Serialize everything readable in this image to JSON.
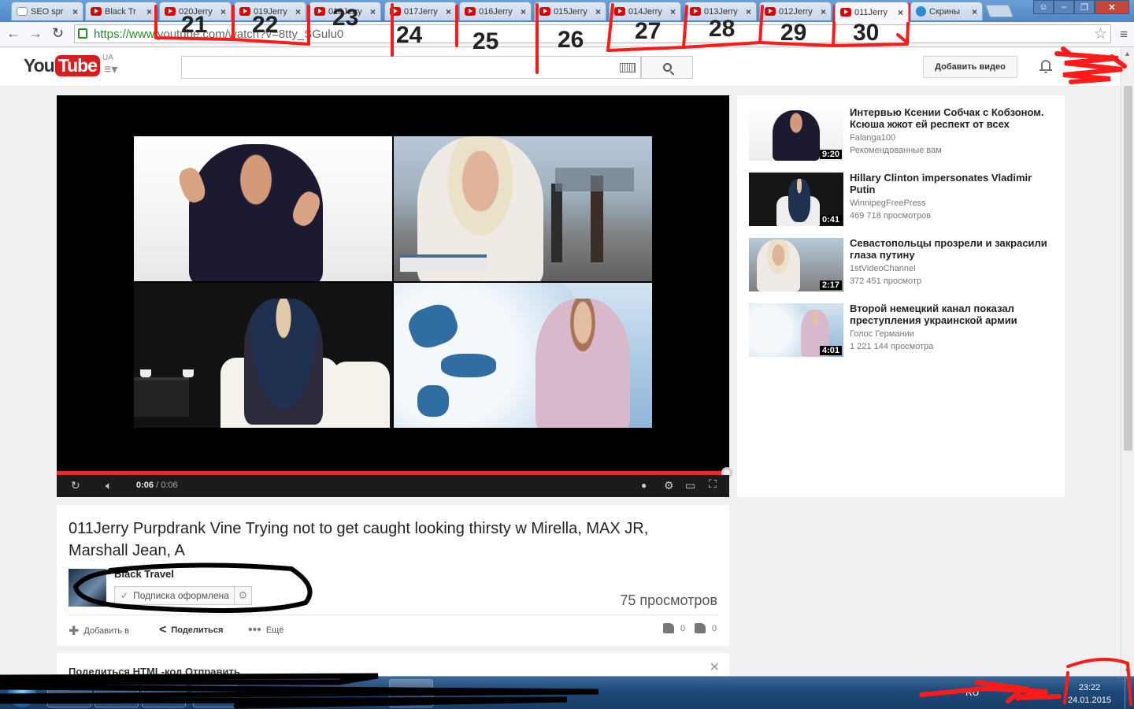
{
  "browser": {
    "tabs": [
      {
        "icon": "seo-favicon-icon",
        "label": "SEO spr",
        "number": ""
      },
      {
        "icon": "youtube-favicon-icon",
        "label": "Black Tr",
        "number": ""
      },
      {
        "icon": "youtube-favicon-icon",
        "label": "020Jerry",
        "number": "21"
      },
      {
        "icon": "youtube-favicon-icon",
        "label": "019Jerry",
        "number": "22"
      },
      {
        "icon": "youtube-favicon-icon",
        "label": "018Jerry",
        "number": "23"
      },
      {
        "icon": "youtube-favicon-icon",
        "label": "017Jerry",
        "number": "24"
      },
      {
        "icon": "youtube-favicon-icon",
        "label": "016Jerry",
        "number": "25"
      },
      {
        "icon": "youtube-favicon-icon",
        "label": "015Jerry",
        "number": "26"
      },
      {
        "icon": "youtube-favicon-icon",
        "label": "014Jerry",
        "number": "27"
      },
      {
        "icon": "youtube-favicon-icon",
        "label": "013Jerry",
        "number": "28"
      },
      {
        "icon": "youtube-favicon-icon",
        "label": "012Jerry",
        "number": "29"
      },
      {
        "icon": "youtube-favicon-icon",
        "label": "011Jerry",
        "number": "30",
        "active": true
      },
      {
        "icon": "vk-favicon-icon",
        "label": "Скрины",
        "number": ""
      }
    ],
    "url_secure": "https://www.",
    "url_rest": "youtube.com/watch?v=8tty_SGulu0",
    "close_glyph": "×"
  },
  "youtube": {
    "logo_you": "You",
    "logo_tube": "Tube",
    "country": "UA",
    "upload_label": "Добавить видео"
  },
  "player": {
    "current_time": "0:06",
    "duration": " / 0:06",
    "progress": 1.0
  },
  "video": {
    "title": "011Jerry Purpdrank Vine Trying not to get caught looking thirsty w Mirella, MAX JR, Marshall Jean, A",
    "channel": "Black Travel",
    "subscribe_state": "Подписка оформлена",
    "views": "75 просмотров",
    "add_to": "Добавить в",
    "share": "Поделиться",
    "more": "Ещё",
    "likes": "0",
    "dislikes": "0"
  },
  "share_panel": {
    "tabs": "Поделиться    HTML-код    Отправить"
  },
  "sidebar": {
    "items": [
      {
        "title": "Интервью Ксении Собчак с Кобзоном. Ксюша жжот ей респект от всех",
        "channel": "Falanga100",
        "meta": "Рекомендованные вам",
        "duration": "9:20"
      },
      {
        "title": "Hillary Clinton impersonates Vladimir Putin",
        "channel": "WinnipegFreePress",
        "meta": "469 718 просмотров",
        "duration": "0:41"
      },
      {
        "title": "Севастопольцы прозрели и закрасили глаза путину",
        "channel": "1stVideoChannel",
        "meta": "372 451 просмотр",
        "duration": "2:17"
      },
      {
        "title": "Второй немецкий канал показал преступления украинской армии",
        "channel": "Голос Германии",
        "meta": "1 221 144 просмотра",
        "duration": "4:01"
      }
    ]
  },
  "taskbar": {
    "lang": "RU",
    "time": "23:22",
    "date": "24.01.2015"
  },
  "colors": {
    "youtube_red": "#e52d27",
    "annotation_red": "#ff1a1a",
    "chrome_blue": "#4f86c4"
  }
}
